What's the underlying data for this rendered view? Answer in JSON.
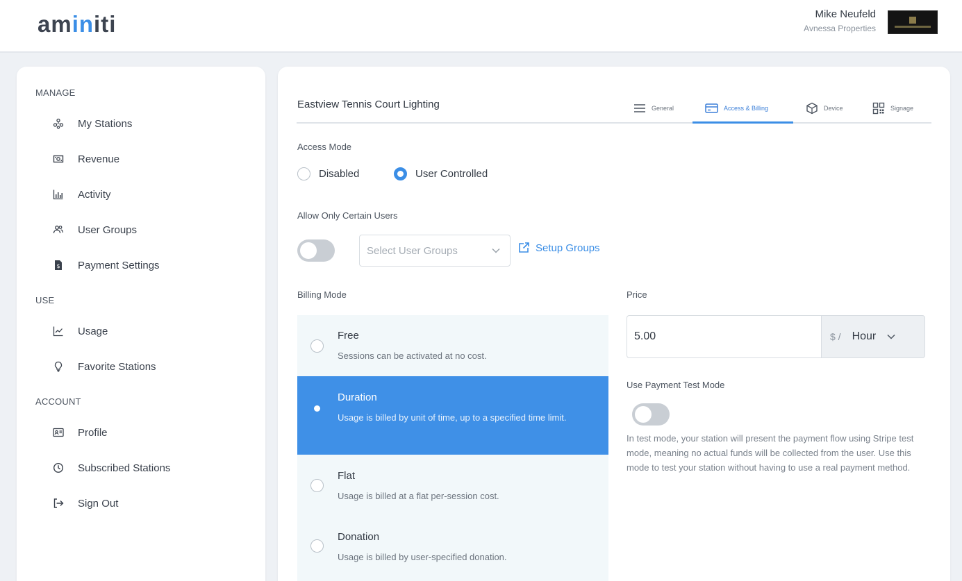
{
  "header": {
    "logo_prefix": "am",
    "logo_accent": "in",
    "logo_suffix": "iti",
    "user_name": "Mike Neufeld",
    "company": "Avnessa Properties"
  },
  "sidebar": {
    "sections": [
      {
        "label": "MANAGE",
        "items": [
          {
            "label": "My Stations",
            "icon": "stations-icon"
          },
          {
            "label": "Revenue",
            "icon": "cash-icon"
          },
          {
            "label": "Activity",
            "icon": "bar-chart-icon"
          },
          {
            "label": "User Groups",
            "icon": "users-icon"
          },
          {
            "label": "Payment Settings",
            "icon": "document-dollar-icon"
          }
        ]
      },
      {
        "label": "USE",
        "items": [
          {
            "label": "Usage",
            "icon": "line-chart-icon"
          },
          {
            "label": "Favorite Stations",
            "icon": "lightbulb-icon"
          }
        ]
      },
      {
        "label": "ACCOUNT",
        "items": [
          {
            "label": "Profile",
            "icon": "id-card-icon"
          },
          {
            "label": "Subscribed Stations",
            "icon": "clock-icon"
          },
          {
            "label": "Sign Out",
            "icon": "sign-out-icon"
          }
        ]
      }
    ]
  },
  "station": {
    "title": "Eastview Tennis Court Lighting",
    "tabs": [
      {
        "label": "General",
        "icon": "list-icon",
        "active": false
      },
      {
        "label": "Access & Billing",
        "icon": "credit-card-icon",
        "active": true
      },
      {
        "label": "Device",
        "icon": "cube-icon",
        "active": false
      },
      {
        "label": "Signage",
        "icon": "qr-code-icon",
        "active": false
      }
    ]
  },
  "access": {
    "label": "Access Mode",
    "options": [
      {
        "label": "Disabled",
        "checked": false
      },
      {
        "label": "User Controlled",
        "checked": true
      }
    ]
  },
  "allow_users": {
    "label": "Allow Only Certain Users",
    "enabled": false,
    "select_placeholder": "Select User Groups",
    "setup_link": "Setup Groups"
  },
  "billing": {
    "label": "Billing Mode",
    "options": [
      {
        "title": "Free",
        "desc": "Sessions can be activated at no cost.",
        "selected": false
      },
      {
        "title": "Duration",
        "desc": "Usage is billed by unit of time, up to a specified time limit.",
        "selected": true
      },
      {
        "title": "Flat",
        "desc": "Usage is billed at a flat per-session cost.",
        "selected": false
      },
      {
        "title": "Donation",
        "desc": "Usage is billed by user-specified donation.",
        "selected": false
      }
    ]
  },
  "price": {
    "label": "Price",
    "value": "5.00",
    "currency": "$ /",
    "unit": "Hour"
  },
  "test_mode": {
    "label": "Use Payment Test Mode",
    "enabled": false,
    "description": "In test mode, your station will present the payment flow using Stripe test mode, meaning no actual funds will be collected from the user. Use this mode to test your station without having to use a real payment method."
  },
  "colors": {
    "accent": "#3b8ee6",
    "selected_row": "#3f90e7",
    "billing_bg": "#f2f8fa"
  }
}
